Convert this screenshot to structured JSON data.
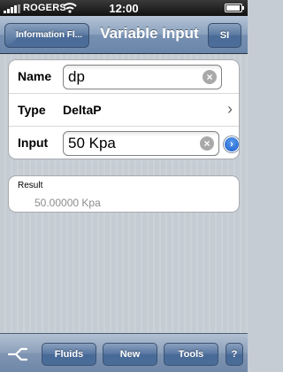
{
  "status_bar": {
    "carrier": "ROGERS",
    "time": "12:00"
  },
  "nav": {
    "back_label": "Information Fl...",
    "title": "Variable Input",
    "right_button": "SI"
  },
  "form": {
    "name": {
      "label": "Name",
      "value": "dp"
    },
    "type": {
      "label": "Type",
      "value": "DeltaP"
    },
    "input": {
      "label": "Input",
      "value": "50 Kpa"
    }
  },
  "result": {
    "label": "Result",
    "value": "50.00000 Kpa"
  },
  "toolbar": {
    "fluids": "Fluids",
    "new": "New",
    "tools": "Tools",
    "help": "?"
  },
  "icons": {
    "clear": "clear-icon",
    "chevron": "chevron-right-icon",
    "disclosure": "disclosure-arrow-icon",
    "toolbar_left": "fork-icon"
  }
}
